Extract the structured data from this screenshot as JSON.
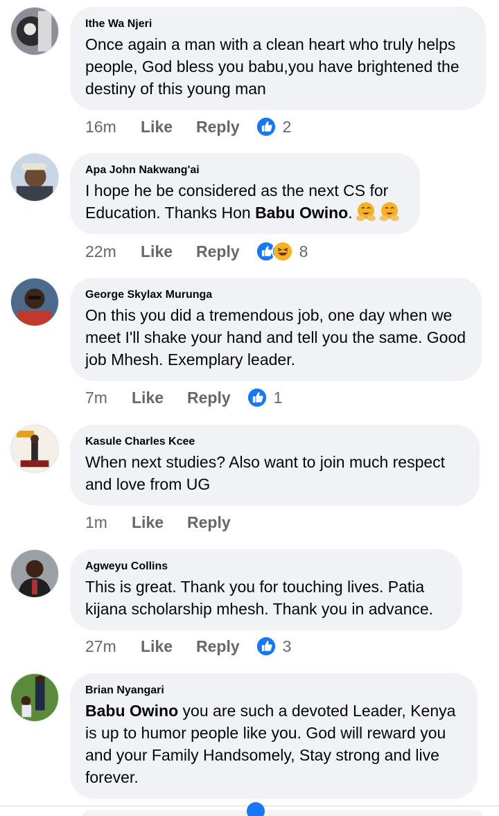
{
  "colors": {
    "bubble": "#f0f2f5",
    "meta": "#65676b",
    "like_blue": "#1877f2",
    "haha_yellow": "#f7b125"
  },
  "comments": [
    {
      "author": "Ithe Wa Njeri",
      "text": "Once again a man with a clean heart who truly helps people, God bless you babu,you have brightened the destiny of this young man",
      "time": "16m",
      "like": "Like",
      "reply": "Reply",
      "reactions": [
        "like-icon"
      ],
      "reaction_count": "2"
    },
    {
      "author": "Apa John Nakwang'ai",
      "text_before": "I hope he be considered as the next CS for Education. Thanks Hon ",
      "text_bold": "Babu Owino",
      "text_after": ".",
      "emojis": [
        "hugging-face-emoji",
        "hugging-face-emoji"
      ],
      "time": "22m",
      "like": "Like",
      "reply": "Reply",
      "reactions": [
        "like-icon",
        "haha-icon"
      ],
      "reaction_count": "8"
    },
    {
      "author": "George Skylax Murunga",
      "text": "On this you did a tremendous job, one day when we meet I'll shake your hand and tell you the same. Good job Mhesh. Exemplary leader.",
      "time": "7m",
      "like": "Like",
      "reply": "Reply",
      "reactions": [
        "like-icon"
      ],
      "reaction_count": "1"
    },
    {
      "author": "Kasule Charles Kcee",
      "text": "When next studies? Also want to join much respect and love from UG",
      "time": "1m",
      "like": "Like",
      "reply": "Reply",
      "reactions": [],
      "reaction_count": ""
    },
    {
      "author": "Agweyu Collins",
      "text": "This is great. Thank you for touching lives. Patia kijana scholarship mhesh. Thank you in advance.",
      "time": "27m",
      "like": "Like",
      "reply": "Reply",
      "reactions": [
        "like-icon"
      ],
      "reaction_count": "3"
    },
    {
      "author": "Brian Nyangari",
      "text_bold": "Babu Owino",
      "text_after": " you are such a devoted Leader, Kenya is up to humor people like you. God will reward you and your Family Handsomely, Stay strong and live forever."
    }
  ]
}
